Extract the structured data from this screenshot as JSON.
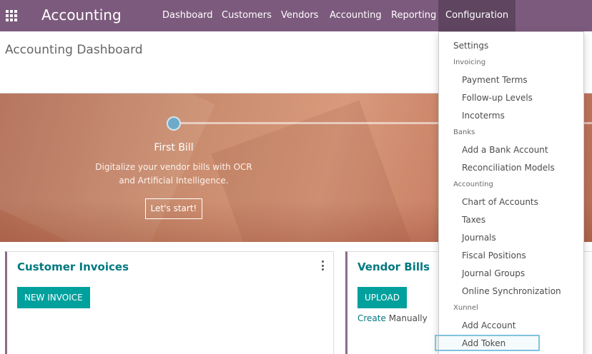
{
  "navbar": {
    "app_title": "Accounting",
    "menu": [
      "Dashboard",
      "Customers",
      "Vendors",
      "Accounting",
      "Reporting",
      "Configuration"
    ],
    "active_menu": "Configuration",
    "apps_icon": "grid-icon",
    "background_color": "#7c5a7d"
  },
  "page": {
    "title": "Accounting Dashboard"
  },
  "onboarding": {
    "step_title": "First Bill",
    "step_description_line1": "Digitalize your vendor bills with OCR",
    "step_description_line2": "and Artificial Intelligence.",
    "button_label": "Let's start!"
  },
  "cards": {
    "customer_invoices": {
      "title": "Customer Invoices",
      "button_label": "NEW INVOICE",
      "menu_icon": "kebab-icon"
    },
    "vendor_bills": {
      "title": "Vendor Bills",
      "button_label": "UPLOAD",
      "link_text": "Create",
      "link_suffix": "Manually"
    }
  },
  "dropdown": {
    "settings": "Settings",
    "sections": [
      {
        "header": "Invoicing",
        "items": [
          "Payment Terms",
          "Follow-up Levels",
          "Incoterms"
        ]
      },
      {
        "header": "Banks",
        "items": [
          "Add a Bank Account",
          "Reconciliation Models"
        ]
      },
      {
        "header": "Accounting",
        "items": [
          "Chart of Accounts",
          "Taxes",
          "Journals",
          "Fiscal Positions",
          "Journal Groups",
          "Online Synchronization"
        ]
      },
      {
        "header": "Xunnel",
        "items": [
          "Add Account",
          "Add Token"
        ]
      }
    ],
    "focused_item": "Add Token"
  },
  "colors": {
    "accent": "#01797f",
    "button": "#00a09d",
    "progress_dot": "#6eaac8",
    "focus_ring": "#7fc3dc"
  }
}
